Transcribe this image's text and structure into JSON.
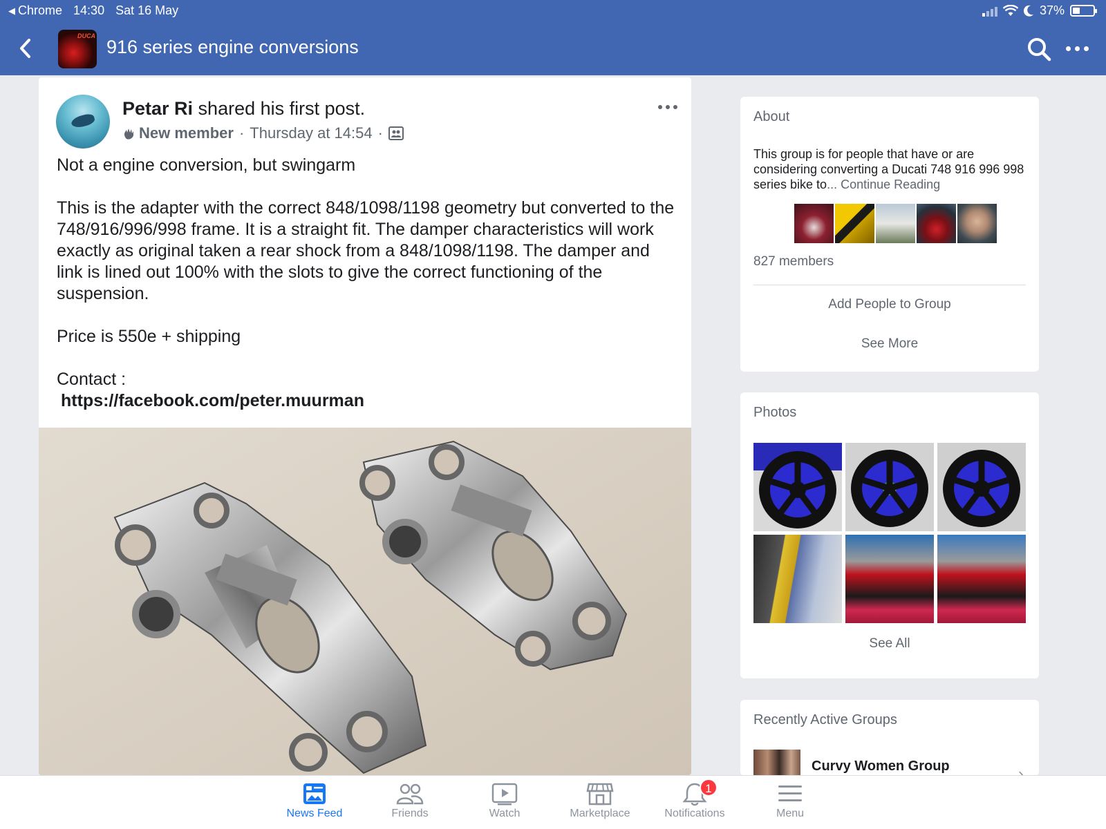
{
  "status_bar": {
    "back_app": "Chrome",
    "time": "14:30",
    "date": "Sat 16 May",
    "battery": "37%",
    "battery_level": 0.37
  },
  "nav": {
    "group_title": "916 series engine conversions",
    "thumb_text": "DUCA"
  },
  "post": {
    "author": "Petar Ri",
    "action": " shared his first post.",
    "badge": "New member",
    "timestamp": "Thursday at 14:54",
    "line1": "Not a engine conversion, but swingarm",
    "para1": "This is the adapter with the correct 848/1098/1198 geometry but converted to the 748/916/996/998 frame. It is a straight fit. The damper characteristics will work exactly as original taken a rear shock from a 848/1098/1198. The damper and link is lined out 100% with the slots to give the correct functioning of the suspension.",
    "price": "Price is 550e + shipping",
    "contact_label": "Contact :",
    "contact_link": "https://facebook.com/peter.muurman"
  },
  "about": {
    "title": "About",
    "description": "This group is for people that have or are considering converting a Ducati 748 916 996 998 series bike to",
    "continue": "... Continue Reading",
    "members": "827 members",
    "add_people": "Add People to Group",
    "see_more": "See More"
  },
  "photos": {
    "title": "Photos",
    "see_all": "See All"
  },
  "recent_groups": {
    "title": "Recently Active Groups",
    "items": [
      {
        "name": "Curvy Women Group"
      }
    ]
  },
  "tabs": [
    {
      "label": "News Feed",
      "icon": "news-feed-icon",
      "active": true
    },
    {
      "label": "Friends",
      "icon": "friends-icon"
    },
    {
      "label": "Watch",
      "icon": "watch-icon"
    },
    {
      "label": "Marketplace",
      "icon": "marketplace-icon"
    },
    {
      "label": "Notifications",
      "icon": "notifications-icon",
      "badge": "1"
    },
    {
      "label": "Menu",
      "icon": "menu-icon"
    }
  ],
  "colors": {
    "brand": "#4267b2",
    "active_tab": "#1877f2",
    "badge": "#fa383e"
  }
}
